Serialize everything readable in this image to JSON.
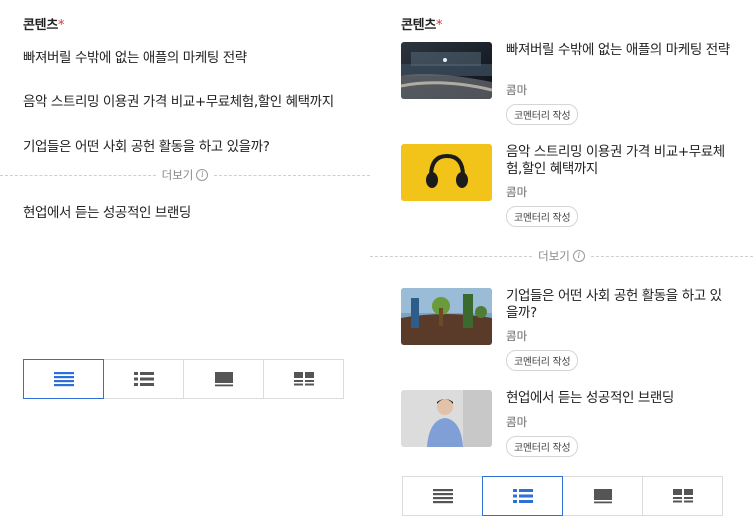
{
  "left": {
    "section_title": "콘텐츠",
    "required_mark": "*",
    "items": [
      "빠져버릴 수밖에 없는 애플의 마케팅 전략",
      "음악 스트리밍 이용권 가격 비교+무료체험,할인 혜택까지",
      "기업들은 어떤 사회 공헌 활동을 하고 있을까?",
      "현업에서 듣는 성공적인 브랜딩"
    ],
    "more_label": "더보기",
    "view_modes": [
      "list-compact-icon",
      "list-thumb-icon",
      "card-icon",
      "grid-icon"
    ],
    "active_view": 0
  },
  "right": {
    "section_title": "콘텐츠",
    "required_mark": "*",
    "cards": [
      {
        "title": "빠져버릴 수밖에 없는 애플의 마케팅 전략",
        "author": "콤마",
        "badge": "코멘터리 작성",
        "thumb": "apple-store-photo"
      },
      {
        "title": "음악 스트리밍 이용권 가격 비교+무료체험,할인 혜택까지",
        "author": "콤마",
        "badge": "코멘터리 작성",
        "thumb": "headphones-photo"
      },
      {
        "title": "기업들은 어떤 사회 공헌 활동을 하고 있을까?",
        "author": "콤마",
        "badge": "코멘터리 작성",
        "thumb": "tree-planting-photo"
      },
      {
        "title": "현업에서 듣는 성공적인 브랜딩",
        "author": "콤마",
        "badge": "코멘터리 작성",
        "thumb": "person-photo"
      }
    ],
    "more_label": "더보기",
    "view_modes": [
      "list-compact-icon",
      "list-thumb-icon",
      "card-icon",
      "grid-icon"
    ],
    "active_view": 1
  },
  "colors": {
    "accent": "#2f6fd8",
    "required": "#e03131",
    "icon": "#555555"
  }
}
